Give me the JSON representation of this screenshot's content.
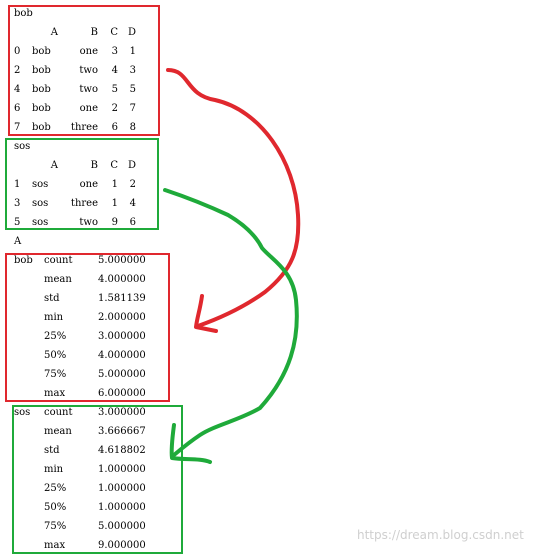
{
  "colors": {
    "red": "#e0282e",
    "green": "#1faa3a",
    "watermark": "#cfcfcf"
  },
  "bob_table": {
    "title": "bob",
    "headers": [
      "A",
      "B",
      "C",
      "D"
    ],
    "rows": [
      [
        "0",
        "bob",
        "one",
        "3",
        "1"
      ],
      [
        "2",
        "bob",
        "two",
        "4",
        "3"
      ],
      [
        "4",
        "bob",
        "two",
        "5",
        "5"
      ],
      [
        "6",
        "bob",
        "one",
        "2",
        "7"
      ],
      [
        "7",
        "bob",
        "three",
        "6",
        "8"
      ]
    ]
  },
  "sos_table": {
    "title": "sos",
    "headers": [
      "A",
      "B",
      "C",
      "D"
    ],
    "rows": [
      [
        "1",
        "sos",
        "one",
        "1",
        "2"
      ],
      [
        "3",
        "sos",
        "three",
        "1",
        "4"
      ],
      [
        "5",
        "sos",
        "two",
        "9",
        "6"
      ]
    ]
  },
  "describe_header": "A",
  "bob_stats": {
    "group": "bob",
    "rows": [
      [
        "count",
        "5.000000"
      ],
      [
        "mean",
        "4.000000"
      ],
      [
        "std",
        "1.581139"
      ],
      [
        "min",
        "2.000000"
      ],
      [
        "25%",
        "3.000000"
      ],
      [
        "50%",
        "4.000000"
      ],
      [
        "75%",
        "5.000000"
      ],
      [
        "max",
        "6.000000"
      ]
    ]
  },
  "sos_stats": {
    "group": "sos",
    "rows": [
      [
        "count",
        "3.000000"
      ],
      [
        "mean",
        "3.666667"
      ],
      [
        "std",
        "4.618802"
      ],
      [
        "min",
        "1.000000"
      ],
      [
        "25%",
        "1.000000"
      ],
      [
        "50%",
        "1.000000"
      ],
      [
        "75%",
        "5.000000"
      ],
      [
        "max",
        "9.000000"
      ]
    ]
  },
  "watermark": "https://dream.blog.csdn.net"
}
